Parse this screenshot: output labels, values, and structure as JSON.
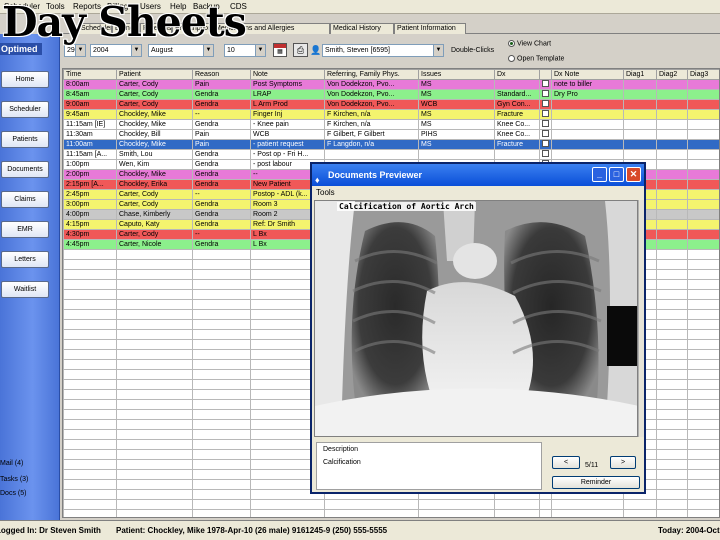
{
  "overlay_title": "Day Sheets",
  "menu": [
    "Scheduler",
    "Tools",
    "Reports",
    "Billing",
    "Users",
    "Help",
    "Backup",
    "CDS"
  ],
  "tabs": [
    "Scheduler",
    "Billing",
    "Referrals",
    "Prescriptions",
    "Medications and Allergies",
    "Medical History",
    "Patient Information"
  ],
  "sidebar": {
    "brand": "Optimed",
    "nav": [
      "Home",
      "Scheduler",
      "Patients",
      "Documents",
      "Claims",
      "EMR",
      "Letters",
      "Waitlist"
    ],
    "counters": [
      "Mail (4)",
      "Tasks (3)",
      "Docs (5)"
    ]
  },
  "filters": {
    "day": "29",
    "year": "2004",
    "month": "August",
    "count": "10",
    "physician": "Smith, Steven [6595]",
    "status": "Double-Clicks",
    "view_chart": "View Chart",
    "open_template": "Open Template"
  },
  "grid": {
    "columns": [
      "Time",
      "Patient",
      "Reason",
      "Note",
      "Referring, Family Phys.",
      "Issues",
      "Dx",
      "",
      "Dx Note",
      "Diag1",
      "Diag2",
      "Diag3"
    ],
    "rows": [
      {
        "color": "magenta",
        "cells": [
          "8:00am",
          "Carter, Cody",
          "Pain",
          "Post Symptoms",
          "Von Dodekzon, Pvo...",
          "MS",
          "",
          "",
          "note to biller",
          "",
          "",
          ""
        ]
      },
      {
        "color": "green",
        "cells": [
          "8:45am",
          "Carter, Cody",
          "Gendra",
          "LRAP",
          "Von Dodekzon, Pvo...",
          "MS",
          "Standard...",
          "",
          "Dry Pro",
          "",
          "",
          ""
        ]
      },
      {
        "color": "red",
        "cells": [
          "9:00am",
          "Carter, Cody",
          "Gendra",
          "L Arm Prod",
          "Von Dodekzon, Pvo...",
          "WCB",
          "Gyn Con...",
          "",
          "",
          "",
          "",
          ""
        ]
      },
      {
        "color": "yellow",
        "cells": [
          "9:45am",
          "Chockley, Mike",
          "--",
          "Finger Inj",
          "F Kirchen, n/a",
          "MS",
          "Fracture",
          "",
          "",
          "",
          "",
          ""
        ]
      },
      {
        "color": "white",
        "cells": [
          "11:15am [IE]",
          "Chockley, Mike",
          "Gendra",
          "- Knee pain",
          "F Kirchen, n/a",
          "MS",
          "Knee Co...",
          "",
          "",
          "",
          "",
          ""
        ]
      },
      {
        "color": "white",
        "cells": [
          "11:30am",
          "Chockley, Bill",
          "Pain",
          "WCB",
          "F Gilbert, F Gilbert",
          "PIHS",
          "Knee Co...",
          "",
          "",
          "",
          "",
          ""
        ]
      },
      {
        "color": "selected",
        "cells": [
          "11:00am",
          "Chockley, Mike",
          "Pain",
          "- patient request",
          "F Langdon, n/a",
          "MS",
          "Fracture",
          "",
          "",
          "",
          "",
          ""
        ]
      },
      {
        "color": "white",
        "cells": [
          "11:15am [A...",
          "Smith, Lou",
          "Gendra",
          "- Post op - Fri H...",
          "",
          "",
          "",
          "",
          "",
          "",
          "",
          ""
        ]
      },
      {
        "color": "white",
        "cells": [
          "1:00pm",
          "Wen, Kim",
          "Gendra",
          "- post labour",
          "",
          "",
          "",
          "",
          "",
          "",
          "",
          ""
        ]
      },
      {
        "color": "magenta",
        "cells": [
          "2:00pm",
          "Chockley, Mike",
          "Gendra",
          "--",
          "",
          "",
          "",
          "",
          "",
          "",
          "",
          ""
        ]
      },
      {
        "color": "red",
        "cells": [
          "2:15pm [A...",
          "Chockley, Erika",
          "Gendra",
          "New Patient",
          "",
          "",
          "",
          "",
          "",
          "",
          "",
          ""
        ]
      },
      {
        "color": "yellow",
        "cells": [
          "2:45pm",
          "Carter, Cody",
          "--",
          "Postop - ADL (k...",
          "",
          "",
          "",
          "",
          "",
          "",
          "",
          ""
        ]
      },
      {
        "color": "yellow",
        "cells": [
          "3:00pm",
          "Carter, Cody",
          "Gendra",
          "Room 3",
          "",
          "",
          "",
          "",
          "",
          "",
          "",
          ""
        ]
      },
      {
        "color": "grey",
        "cells": [
          "4:00pm",
          "Chase, Kimberly",
          "Gendra",
          "Room 2",
          "",
          "",
          "",
          "",
          "",
          "",
          "",
          ""
        ]
      },
      {
        "color": "yellow",
        "cells": [
          "4:15pm",
          "Caputo, Katy",
          "Gendra",
          "Ref: Dr Smith",
          "",
          "",
          "",
          "",
          "",
          "",
          "",
          ""
        ]
      },
      {
        "color": "red",
        "cells": [
          "4:30pm",
          "Carter, Cody",
          "--",
          "L Bx",
          "",
          "",
          "",
          "",
          "",
          "",
          "",
          ""
        ]
      },
      {
        "color": "green",
        "cells": [
          "4:45pm",
          "Carter, Nicole",
          "Gendra",
          "L Bx",
          "",
          "",
          "",
          "",
          "",
          "",
          "",
          ""
        ]
      }
    ]
  },
  "statusbar": {
    "logged_in": "Logged In: Dr Steven Smith",
    "patient": "Patient: Chockley, Mike 1978-Apr-10 (26 male) 9161245-9 (250) 555-5555",
    "today": "Today: 2004-Oct-"
  },
  "dialog": {
    "title": "Documents Previewer",
    "menu": "Tools",
    "caption": "Calcification of Aortic Arch",
    "description_label": "Description",
    "description_value": "Calcification",
    "pager_prev": "<",
    "pager_text": "5/11",
    "pager_next": ">",
    "reminder": "Reminder"
  },
  "colors": {
    "sidebar": "#4a74d8",
    "selected_row": "#316ac5",
    "title_bar": "#0a4ed8",
    "row_magenta": "#e87ad8",
    "row_green": "#8cf08c",
    "row_red": "#f05858",
    "row_yellow": "#f4f46e",
    "row_grey": "#c8c8c8"
  }
}
